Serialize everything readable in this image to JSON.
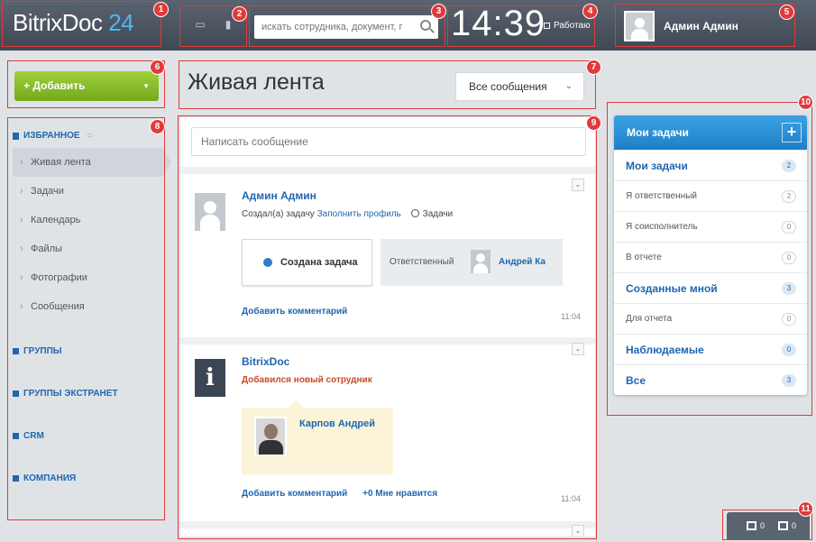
{
  "header": {
    "logo_text": "BitrixDoc",
    "logo_number": "24",
    "search_placeholder": "искать сотрудника, документ, г",
    "clock": "14:39",
    "status": "Работаю",
    "user_name": "Админ Админ"
  },
  "left": {
    "add_button": "Добавить",
    "favorites": "ИЗБРАННОЕ",
    "items": [
      {
        "label": "Живая лента",
        "active": true
      },
      {
        "label": "Задачи"
      },
      {
        "label": "Календарь"
      },
      {
        "label": "Файлы"
      },
      {
        "label": "Фотографии"
      },
      {
        "label": "Сообщения"
      }
    ],
    "groups": [
      {
        "label": "ГРУППЫ"
      },
      {
        "label": "ГРУППЫ ЭКСТРАНЕТ"
      },
      {
        "label": "CRM"
      },
      {
        "label": "КОМПАНИЯ"
      }
    ]
  },
  "main": {
    "title": "Живая лента",
    "filter": "Все сообщения",
    "composer_placeholder": "Написать сообщение",
    "posts": [
      {
        "author": "Админ Админ",
        "action": "Создал(а) задачу",
        "link": "Заполнить профиль",
        "tasks_label": "Задачи",
        "task_card": "Создана задача",
        "responsible_label": "Ответственный",
        "responsible_name": "Андрей Ка",
        "comment": "Добавить комментарий",
        "time": "11:04"
      },
      {
        "author": "BitrixDoc",
        "subtitle": "Добавился новый сотрудник",
        "employee": "Карпов Андрей",
        "comment": "Добавить комментарий",
        "likes": "0",
        "like_label": "Мне нравится",
        "time": "11:04"
      }
    ]
  },
  "tasks": {
    "header": "Мои задачи",
    "rows": [
      {
        "label": "Мои задачи",
        "count": "2",
        "bold": true
      },
      {
        "label": "Я ответственный",
        "count": "2",
        "bold": false
      },
      {
        "label": "Я соисполнитель",
        "count": "0",
        "bold": false
      },
      {
        "label": "В отчете",
        "count": "0",
        "bold": false
      },
      {
        "label": "Созданные мной",
        "count": "3",
        "bold": true
      },
      {
        "label": "Для отчета",
        "count": "0",
        "bold": false
      },
      {
        "label": "Наблюдаемые",
        "count": "0",
        "bold": true
      },
      {
        "label": "Все",
        "count": "3",
        "bold": true
      }
    ]
  },
  "bottom_widget": {
    "messages_count": "0",
    "notifications_count": "0"
  },
  "callouts": [
    "1",
    "2",
    "3",
    "4",
    "5",
    "6",
    "7",
    "8",
    "9",
    "10",
    "11"
  ],
  "colors": {
    "accent_blue": "#2067b0",
    "callout_red": "#e03a3a",
    "add_green": "#8cc230"
  }
}
